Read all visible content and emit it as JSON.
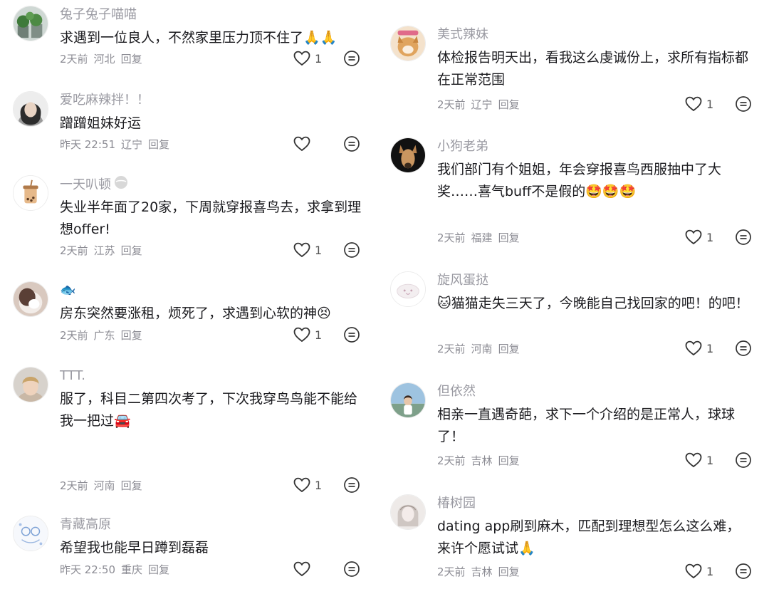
{
  "left_column": [
    {
      "username": "兔子兔子喵喵",
      "text": "求遇到一位良人，不然家里压力顶不住了🙏🙏",
      "time": "2天前",
      "location": "河北",
      "reply": "回复",
      "likes": "1",
      "avatar": "plant"
    },
    {
      "username": "爱吃麻辣拌！！",
      "text": "蹭蹭姐妹好运",
      "time": "昨天 22:51",
      "location": "辽宁",
      "reply": "回复",
      "likes": "",
      "avatar": "girl"
    },
    {
      "username": "一天叭顿",
      "text": "失业半年面了20家，下周就穿报喜鸟去，求拿到理想offer!",
      "time": "2天前",
      "location": "江苏",
      "reply": "回复",
      "likes": "1",
      "avatar": "bubble-tea"
    },
    {
      "username": "🐟",
      "text": "房东突然要涨租，烦死了，求遇到心软的神😣",
      "time": "2天前",
      "location": "广东",
      "reply": "回复",
      "likes": "1",
      "avatar": "cat-face"
    },
    {
      "username": "TTT.",
      "text": "服了，科目二第四次考了，下次我穿鸟鸟能不能给我一把过🚘",
      "time": "2天前",
      "location": "河南",
      "reply": "回复",
      "likes": "1",
      "avatar": "boy"
    },
    {
      "username": "青藏高原",
      "text": "希望我也能早日蹲到磊磊",
      "time": "昨天 22:50",
      "location": "重庆",
      "reply": "回复",
      "likes": "",
      "avatar": "doodle"
    }
  ],
  "right_column": [
    {
      "username": "美式辣妹",
      "text": "体检报告明天出，看我这么虔诚份上，求所有指标都在正常范围",
      "time": "2天前",
      "location": "辽宁",
      "reply": "回复",
      "likes": "1",
      "avatar": "dog"
    },
    {
      "username": "小狗老弟",
      "text": "我们部门有个姐姐，年会穿报喜鸟西服抽中了大奖……喜气buff不是假的🤩🤩🤩",
      "time": "2天前",
      "location": "福建",
      "reply": "回复",
      "likes": "1",
      "avatar": "kangaroo"
    },
    {
      "username": "旋风蛋挞",
      "text": "🐱猫猫走失三天了，今晚能自己找回家的吧！的吧！",
      "time": "2天前",
      "location": "河南",
      "reply": "回复",
      "likes": "1",
      "avatar": "cloud"
    },
    {
      "username": "但依然",
      "text": "相亲一直遇奇葩，求下一个介绍的是正常人，球球了！",
      "time": "2天前",
      "location": "吉林",
      "reply": "回复",
      "likes": "1",
      "avatar": "beach"
    },
    {
      "username": "椿树园",
      "text": "dating app刷到麻木，匹配到理想型怎么这么难，来许个愿试试🙏",
      "time": "2天前",
      "location": "吉林",
      "reply": "回复",
      "likes": "1",
      "avatar": "sketch"
    }
  ],
  "colors": {
    "meta": "#8c8c94",
    "username": "#9a9aa2",
    "text": "#1b1b1f"
  },
  "icons": {
    "like": "heart-icon",
    "more": "comment-more-icon"
  }
}
